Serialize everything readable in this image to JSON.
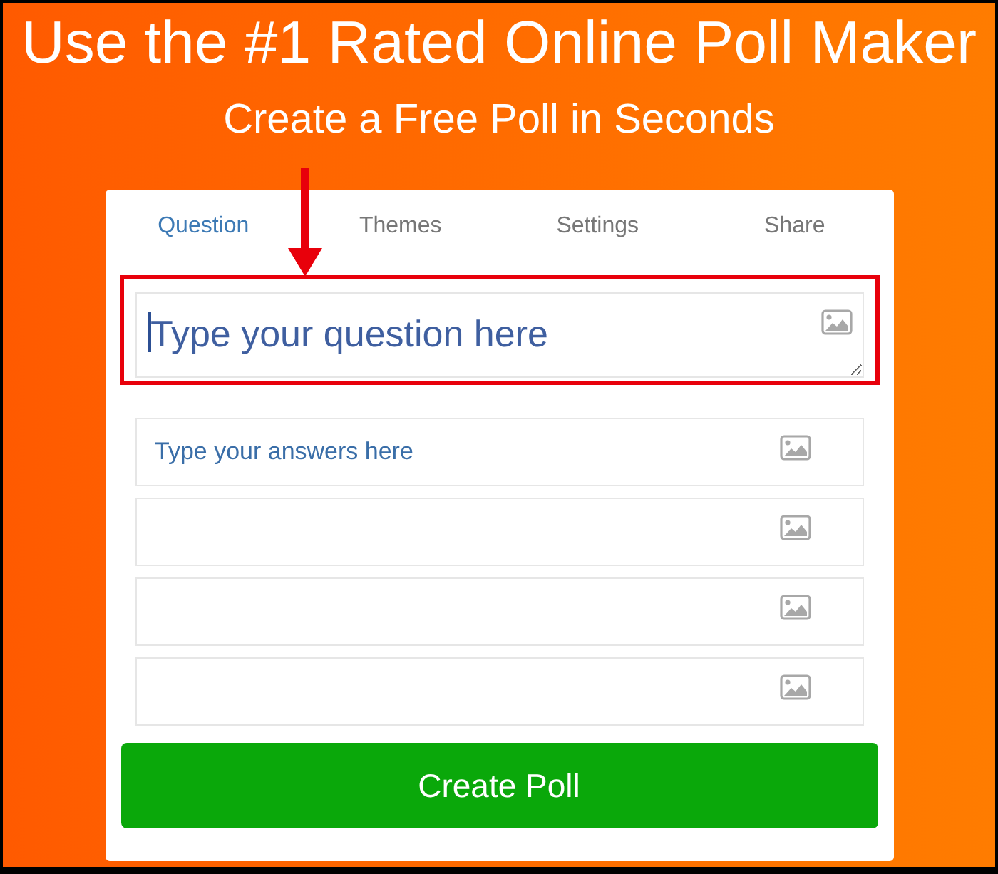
{
  "heading": {
    "title": "Use the #1 Rated Online Poll Maker",
    "subtitle": "Create a Free Poll in Seconds"
  },
  "tabs": [
    {
      "label": "Question",
      "selected": true
    },
    {
      "label": "Themes",
      "selected": false
    },
    {
      "label": "Settings",
      "selected": false
    },
    {
      "label": "Share",
      "selected": false
    }
  ],
  "question": {
    "placeholder": "Type your question here",
    "focused": true,
    "highlighted": true
  },
  "answers": [
    {
      "placeholder": "Type your answers here",
      "image_button": true
    },
    {
      "image_button": true
    },
    {
      "image_button": true
    },
    {
      "image_button": true
    }
  ],
  "submit_button": {
    "label": "Create Poll"
  }
}
